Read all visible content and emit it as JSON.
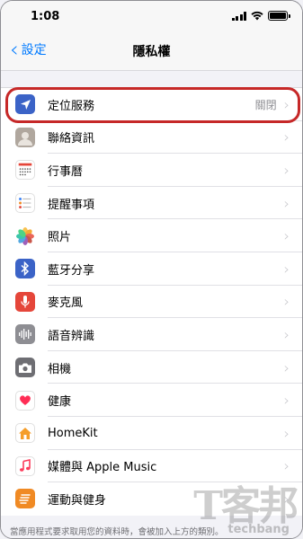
{
  "status_bar": {
    "time": "1:08"
  },
  "nav": {
    "back_label": "設定",
    "title": "隱私權"
  },
  "rows": [
    {
      "label": "定位服務",
      "value": "關閉",
      "icon": "location-arrow-icon",
      "color": "#3b63c7"
    },
    {
      "label": "聯絡資訊",
      "value": "",
      "icon": "contacts-icon",
      "color": "#b0a79e"
    },
    {
      "label": "行事曆",
      "value": "",
      "icon": "calendar-icon",
      "color": "#ffffff"
    },
    {
      "label": "提醒事項",
      "value": "",
      "icon": "reminders-icon",
      "color": "#ffffff"
    },
    {
      "label": "照片",
      "value": "",
      "icon": "photos-icon",
      "color": "#ffffff"
    },
    {
      "label": "藍牙分享",
      "value": "",
      "icon": "bluetooth-icon",
      "color": "#3b63c7"
    },
    {
      "label": "麥克風",
      "value": "",
      "icon": "microphone-icon",
      "color": "#e5463a"
    },
    {
      "label": "語音辨識",
      "value": "",
      "icon": "speech-waveform-icon",
      "color": "#8e8e93"
    },
    {
      "label": "相機",
      "value": "",
      "icon": "camera-icon",
      "color": "#6e6e73"
    },
    {
      "label": "健康",
      "value": "",
      "icon": "health-heart-icon",
      "color": "#ffffff"
    },
    {
      "label": "HomeKit",
      "value": "",
      "icon": "homekit-house-icon",
      "color": "#ffffff"
    },
    {
      "label": "媒體與 Apple Music",
      "value": "",
      "icon": "music-note-icon",
      "color": "#ffffff"
    },
    {
      "label": "運動與健身",
      "value": "",
      "icon": "motion-fitness-icon",
      "color": "#f08a24"
    }
  ],
  "footer_note": "當應用程式要求取用您的資料時，會被加入上方的類別。",
  "watermark": {
    "main": "T客邦",
    "sub": "techbang"
  },
  "colors": {
    "accent": "#007aff",
    "highlight": "#c62828"
  }
}
